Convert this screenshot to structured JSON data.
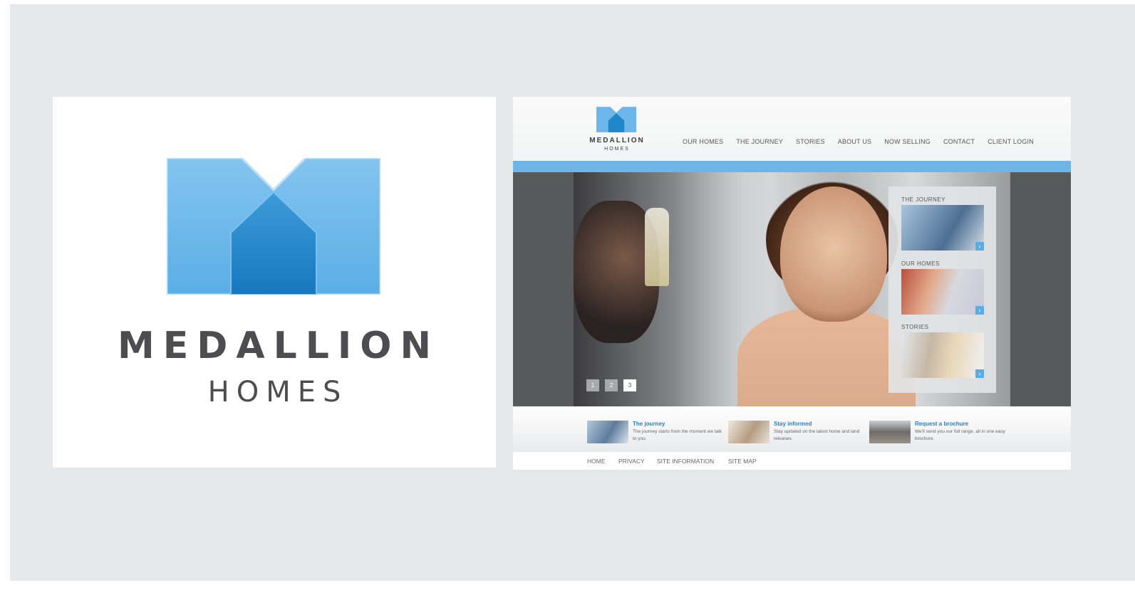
{
  "logo": {
    "word1": "MEDALLION",
    "word2": "HOMES",
    "icon": "medallion-m-house-icon",
    "colors": {
      "light": "#6cb6ea",
      "dark": "#1c84c9",
      "text": "#4d4d4f"
    }
  },
  "site": {
    "brand": {
      "word1": "MEDALLION",
      "word2": "HOMES"
    },
    "nav": [
      "OUR HOMES",
      "THE JOURNEY",
      "STORIES",
      "ABOUT US",
      "NOW SELLING",
      "CONTACT",
      "CLIENT LOGIN"
    ],
    "accent": "#6fb4e6",
    "pager": [
      "1",
      "2",
      "3"
    ],
    "pager_active": "3",
    "panel": [
      {
        "title": "THE JOURNEY",
        "arrow": "›"
      },
      {
        "title": "OUR HOMES",
        "arrow": "›"
      },
      {
        "title": "STORIES",
        "arrow": "›"
      }
    ],
    "promos": [
      {
        "title": "The journey",
        "text": "The journey starts from the moment we talk to you."
      },
      {
        "title": "Stay informed",
        "text": "Stay updated on the latest home and land releases."
      },
      {
        "title": "Request a brochure",
        "text": "We'll send you our full range, all in one easy brochure."
      }
    ],
    "footer": [
      "HOME",
      "PRIVACY",
      "SITE INFORMATION",
      "SITE MAP"
    ]
  }
}
